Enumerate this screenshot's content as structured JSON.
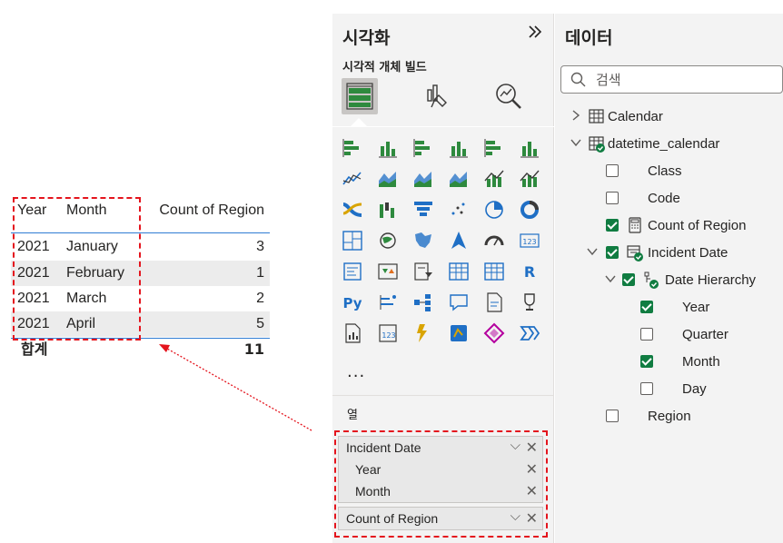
{
  "table_visual": {
    "headers": [
      "Year",
      "Month",
      "Count of Region"
    ],
    "rows": [
      {
        "year": "2021",
        "month": "January",
        "count": "3"
      },
      {
        "year": "2021",
        "month": "February",
        "count": "1"
      },
      {
        "year": "2021",
        "month": "March",
        "count": "2"
      },
      {
        "year": "2021",
        "month": "April",
        "count": "5"
      }
    ],
    "total_label": "합계",
    "total_value": "11"
  },
  "viz_pane": {
    "title": "시각화",
    "build_label": "시각적 개체 빌드",
    "more": "...",
    "columns_label": "열",
    "wells": [
      {
        "field": "Incident Date",
        "children": [
          "Year",
          "Month"
        ]
      },
      {
        "field": "Count of Region",
        "children": []
      }
    ],
    "visual_icons": [
      "stacked-bar-icon",
      "stacked-column-icon",
      "clustered-bar-icon",
      "clustered-column-icon",
      "100-stacked-bar-icon",
      "100-stacked-column-icon",
      "line-chart-icon",
      "area-chart-icon",
      "stacked-area-icon",
      "100-stacked-area-icon",
      "line-clustered-column-icon",
      "line-stacked-column-icon",
      "ribbon-chart-icon",
      "waterfall-icon",
      "funnel-icon",
      "scatter-icon",
      "pie-chart-icon",
      "donut-chart-icon",
      "treemap-icon",
      "map-icon",
      "filled-map-icon",
      "azure-map-icon",
      "gauge-icon",
      "card-icon",
      "multi-row-card-icon",
      "kpi-icon",
      "slicer-icon",
      "table-icon",
      "matrix-icon",
      "r-visual-icon",
      "python-visual-icon",
      "key-influencers-icon",
      "decomposition-tree-icon",
      "qa-icon",
      "narrative-icon",
      "goals-icon",
      "paginated-report-icon",
      "card-new-icon",
      "power-automate-icon",
      "azure-maps-icon",
      "power-apps-icon",
      "more-visuals-icon"
    ]
  },
  "data_pane": {
    "title": "데이터",
    "search_placeholder": "검색",
    "tables": [
      {
        "name": "Calendar",
        "expanded": false
      },
      {
        "name": "datetime_calendar",
        "expanded": true
      }
    ],
    "fields": [
      {
        "name": "Class",
        "checked": false
      },
      {
        "name": "Code",
        "checked": false
      },
      {
        "name": "Count of Region",
        "checked": true
      },
      {
        "name": "Incident Date",
        "checked": true
      },
      {
        "name": "Date Hierarchy",
        "checked": true
      },
      {
        "name": "Year",
        "checked": true
      },
      {
        "name": "Quarter",
        "checked": false
      },
      {
        "name": "Month",
        "checked": true
      },
      {
        "name": "Day",
        "checked": false
      },
      {
        "name": "Region",
        "checked": false
      }
    ]
  },
  "colors": {
    "accent_blue": "#2f7cd3",
    "check_green": "#107c41",
    "annotation_red": "#e4141d"
  }
}
